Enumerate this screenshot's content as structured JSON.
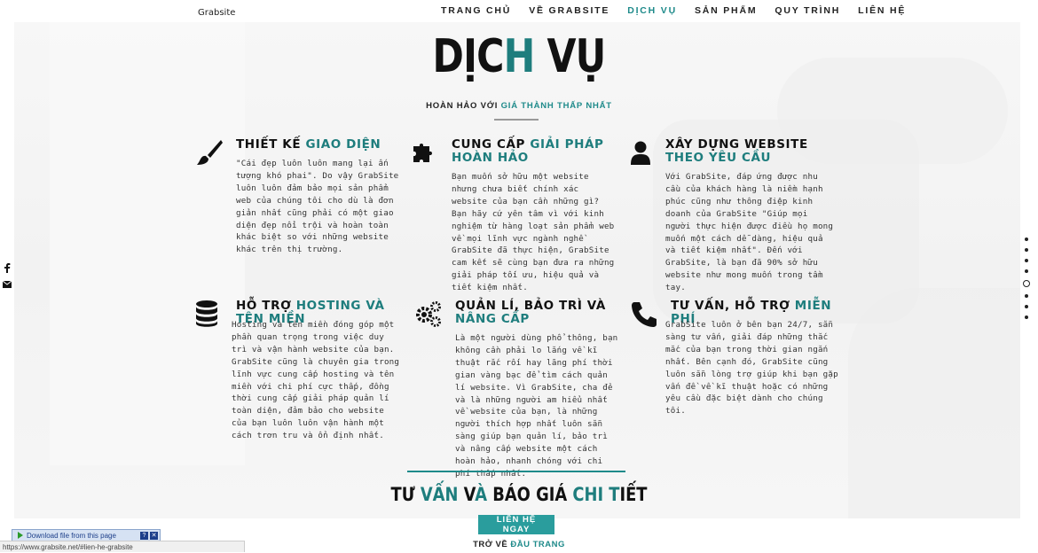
{
  "nav": {
    "brand": "Grabsite",
    "items": [
      {
        "label": "TRANG CHỦ",
        "active": false
      },
      {
        "label": "VỀ GRABSITE",
        "active": false
      },
      {
        "label": "DỊCH VỤ",
        "active": true
      },
      {
        "label": "SẢN PHẨM",
        "active": false
      },
      {
        "label": "QUY TRÌNH",
        "active": false
      },
      {
        "label": "LIÊN HỆ",
        "active": false
      }
    ]
  },
  "hero": {
    "title_a": "DỊC",
    "title_b": "H",
    "title_c": " VỤ",
    "subtitle_a": "HOÀN HẢO VỚI ",
    "subtitle_b": "GIÁ THÀNH THẤP NHẤT"
  },
  "services": [
    {
      "icon": "paintbrush-icon",
      "title_a": "THIẾT KẾ ",
      "title_b": "GIAO DIỆN",
      "body": "\"Cái đẹp luôn luôn mang lại ấn tượng khó phai\". Do vậy GrabSite luôn luôn đảm bảo mọi sản phẩm web của chúng tôi cho dù là đơn giản nhất cũng phải có một giao diện đẹp nổi trội và hoàn toàn khác biệt so với những website khác trên thị trường."
    },
    {
      "icon": "puzzle-icon",
      "title_a": "CUNG CẤP ",
      "title_b": "GIẢI PHÁP HOÀN HẢO",
      "body": "Bạn muốn sở hữu một website nhưng chưa biết chính xác website của bạn cần những gì? Bạn hãy cứ yên tâm vì với kinh nghiệm từ hàng loạt sản phẩm web về mọi lĩnh vực ngành nghề GrabSite đã thực hiện, GrabSite cam kết sẽ cùng bạn đưa ra những giải pháp tối ưu, hiệu quả và tiết kiệm nhất."
    },
    {
      "icon": "user-icon",
      "title_a": "XÂY DỰNG WEBSITE ",
      "title_b": "THEO YÊU CẦU",
      "body": "Với GrabSite, đáp ứng được nhu cầu của khách hàng là niềm hạnh phúc cũng như thông điệp kinh doanh của GrabSite \"Giúp mọi người thực hiện được điều họ mong muốn một cách dễ dàng, hiệu quả và tiết kiệm nhất\". Đến với GrabSite, là bạn đã 90% sở hữu website như mong muốn trong tầm tay."
    },
    {
      "icon": "database-icon",
      "title_a": "HỖ TRỢ ",
      "title_b": "HOSTING VÀ TÊN MIỀN",
      "body": "Hosting và tên miền đóng góp một phần quan trọng trong việc duy trì và vận hành website của bạn. GrabSite cũng là chuyên gia trong lĩnh vực cung cấp hosting và tên miền với chi phí cực thấp, đồng thời cung cấp giải pháp quản lí toàn diện, đảm bảo cho website của bạn luôn luôn vận hành một cách trơn tru và ổn định nhất."
    },
    {
      "icon": "gears-icon",
      "title_a": "QUẢN LÍ, BẢO TRÌ VÀ ",
      "title_b": "NÂNG CẤP",
      "body": "Là một người dùng phổ thông, bạn không cần phải lo lắng về kĩ thuật rắc rối hay lãng phí thời gian vàng bạc để tìm cách quản lí website. Vì GrabSite, cha đẻ và là những người am hiểu nhất về website của bạn, là những người thích hợp nhất luôn sẵn sàng giúp bạn quản lí, bảo trì và nâng cấp website một cách hoàn hảo, nhanh chóng với chi phí thấp nhất."
    },
    {
      "icon": "phone-icon",
      "title_a": "TƯ VẤN, HỖ TRỢ ",
      "title_b": "MIỄN PHÍ",
      "body": "GrabSite luôn ở bên bạn 24/7, sẵn sàng tư vấn, giải đáp những thắc mắc của bạn trong thời gian ngắn nhất. Bên cạnh đó, GrabSite cũng luôn sẵn lòng trợ giúp khi bạn gặp vấn đề về kĩ thuật hoặc có những yêu cầu đặc biệt dành cho chúng tôi."
    }
  ],
  "cta": {
    "t1": "TƯ ",
    "t2": "VẤN",
    "t3": " V",
    "t4": "À",
    "t5": " BÁO GIÁ ",
    "t6": "CHI T",
    "t7": "IẾT",
    "button": "LIÊN HỆ NGAY",
    "back_a": "TRỞ VỀ ",
    "back_b": "ĐẦU TRANG"
  },
  "browser": {
    "download_label": "Download file from this page",
    "status_url": "https://www.grabsite.net/#lien-he-grabsite"
  }
}
